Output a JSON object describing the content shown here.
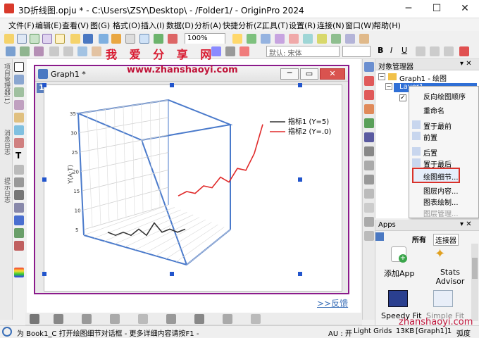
{
  "window": {
    "title": "3D折线图.opju * - C:\\Users\\ZSY\\Desktop\\ - /Folder1/ - OriginPro 2024"
  },
  "menu": [
    "文件(F)",
    "编辑(E)",
    "查看(V)",
    "图(G)",
    "格式(O)",
    "插入(I)",
    "数据(D)",
    "分析(A)",
    "快捷分析(Z)",
    "工具(T)",
    "设置(R)",
    "连接(N)",
    "窗口(W)",
    "帮助(H)"
  ],
  "toolbar": {
    "zoom": "100%",
    "font": "默认: 宋体"
  },
  "left_panel_tabs": [
    "项目管理器(1)",
    "消息日志",
    "提示日志"
  ],
  "graph_window": {
    "title": "Graph1 *",
    "layer_badge": "1"
  },
  "chart_data": {
    "type": "line",
    "title": "",
    "zlabel": "Y(A:T)",
    "zticks": [
      "5",
      "10",
      "15",
      "20",
      "25",
      "30",
      "35"
    ],
    "zlim": [
      5,
      35
    ],
    "legend_placement": "top-right",
    "series": [
      {
        "name": "指标1 (Y=5)",
        "color": "#333333",
        "values": [
          8,
          7,
          8,
          7,
          9,
          7,
          11,
          8,
          9,
          8,
          9
        ]
      },
      {
        "name": "指标2 (Y=.0)",
        "color": "#e02a2a",
        "values": [
          12,
          13,
          12,
          14,
          13,
          16,
          14,
          18,
          17,
          22,
          31
        ]
      }
    ]
  },
  "object_manager": {
    "title": "对象管理器",
    "tree": [
      "Graph1 - 绘图",
      "Layer1"
    ]
  },
  "context_menu": [
    "反向绘图顺序",
    "重命名",
    "置于最前",
    "前置",
    "后置",
    "置于最后",
    "绘图细节...",
    "图层内容...",
    "图表绘制...",
    "图层管理..."
  ],
  "apps": {
    "title": "Apps",
    "tabs": [
      "所有",
      "连接器"
    ],
    "items": [
      "添加App",
      "Stats Advisor",
      "Speedy Fit",
      "Simple Fit"
    ]
  },
  "feedback_link": ">>反馈",
  "status": {
    "message": "为 Book1_C 打开绘图细节对话框 - 更多详细内容请按F1 -",
    "au": "AU : 开",
    "grids": "Light Grids",
    "size": "13KB",
    "layer": "[Graph1]1",
    "unit": "弧度"
  },
  "watermark": {
    "brand": "我 爱 分 享 网",
    "url": "www.zhanshaoyi.com",
    "url2": "zhanshaoyi.com"
  }
}
